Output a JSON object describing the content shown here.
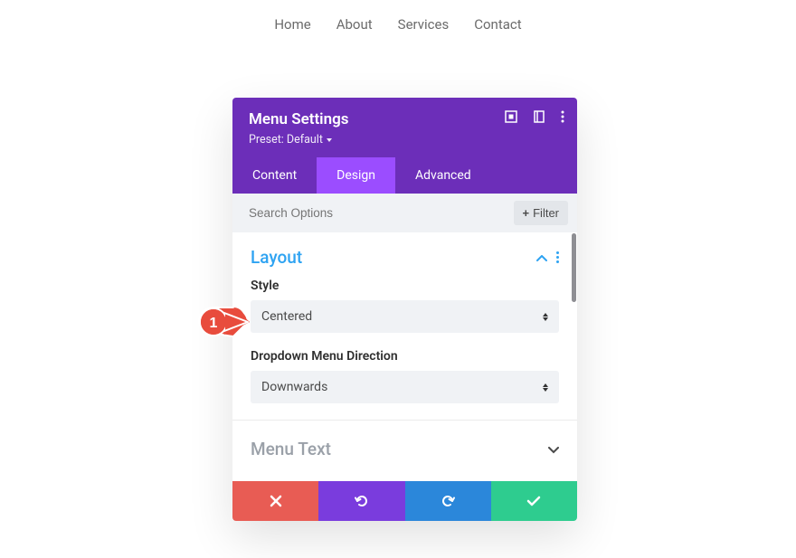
{
  "nav": {
    "items": [
      "Home",
      "About",
      "Services",
      "Contact"
    ]
  },
  "panel": {
    "title": "Menu Settings",
    "preset_label": "Preset: Default",
    "tabs": {
      "content": "Content",
      "design": "Design",
      "advanced": "Advanced"
    },
    "search_placeholder": "Search Options",
    "filter_label": "Filter"
  },
  "layout_section": {
    "title": "Layout",
    "fields": {
      "style_label": "Style",
      "style_value": "Centered",
      "direction_label": "Dropdown Menu Direction",
      "direction_value": "Downwards"
    }
  },
  "menu_text_section": {
    "title": "Menu Text"
  },
  "callout": {
    "number": "1"
  }
}
